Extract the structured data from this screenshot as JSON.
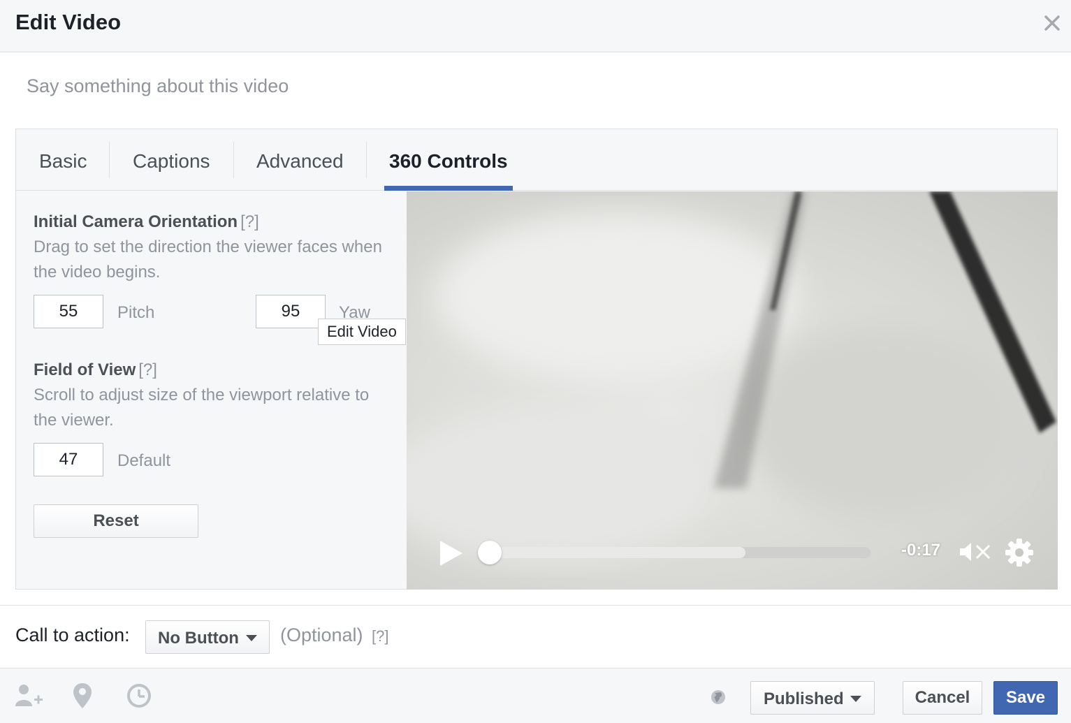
{
  "dialog": {
    "title": "Edit Video",
    "close_icon": "close-icon"
  },
  "composer": {
    "placeholder": "Say something about this video"
  },
  "tabs": [
    {
      "label": "Basic",
      "active": false
    },
    {
      "label": "Captions",
      "active": false
    },
    {
      "label": "Advanced",
      "active": false
    },
    {
      "label": "360 Controls",
      "active": true
    }
  ],
  "camera": {
    "title": "Initial Camera Orientation",
    "help": "[?]",
    "description": "Drag to set the direction the viewer faces when the video begins.",
    "pitch_value": "55",
    "pitch_label": "Pitch",
    "yaw_value": "95",
    "yaw_label": "Yaw"
  },
  "fov": {
    "title": "Field of View",
    "help": "[?]",
    "description": "Scroll to adjust size of the viewport relative to the viewer.",
    "value": "47",
    "label": "Default"
  },
  "reset_label": "Reset",
  "tooltip": "Edit Video",
  "player": {
    "time": "-0:17",
    "progress": 0.0,
    "buffered": 0.68,
    "icons": [
      "play-icon",
      "mute-icon",
      "gear-icon"
    ]
  },
  "cta": {
    "label": "Call to action:",
    "button": "No Button",
    "optional": "(Optional)",
    "help": "[?]"
  },
  "footer": {
    "icons": [
      "tag-people-icon",
      "location-pin-icon",
      "clock-icon",
      "globe-icon"
    ],
    "privacy": "Published",
    "cancel": "Cancel",
    "save": "Save"
  },
  "colors": {
    "accent": "#4267b2",
    "header_bg": "#f6f7f9",
    "muted_text": "#90949c"
  }
}
